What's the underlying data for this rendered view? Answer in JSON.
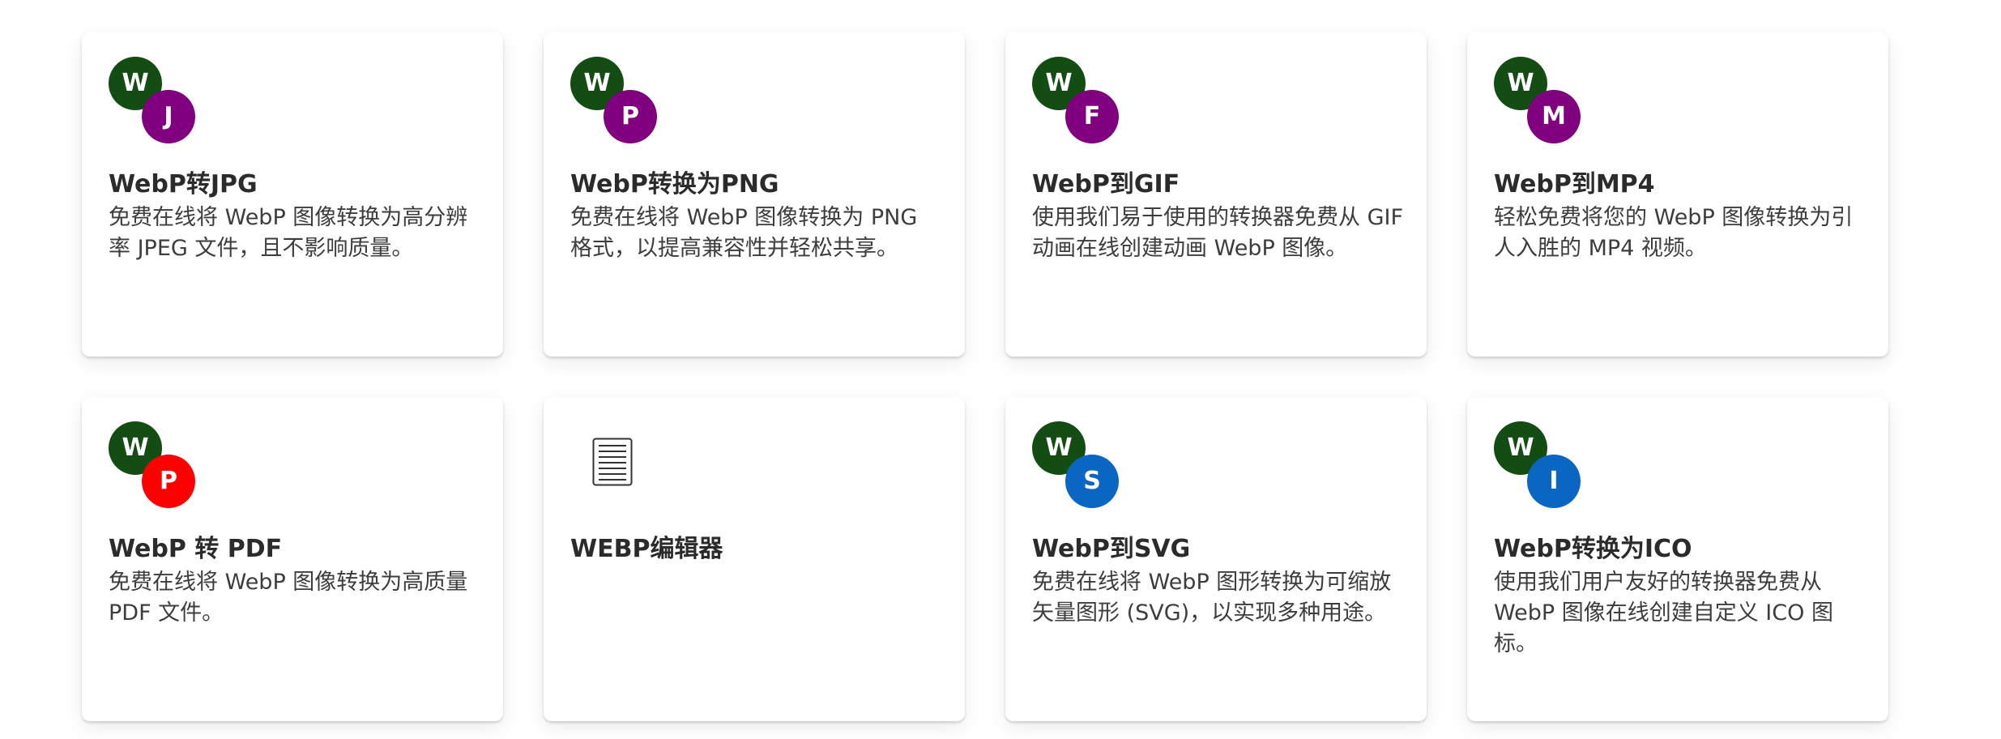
{
  "cards": [
    {
      "title": "WebP转JPG",
      "description": "免费在线将 WebP 图像转换为高分辨率 JPEG 文件，且不影响质量。",
      "icon_from": "W",
      "icon_to": "J",
      "from_color": "#144d14",
      "to_color": "#800080"
    },
    {
      "title": "WebP转换为PNG",
      "description": "免费在线将 WebP 图像转换为 PNG 格式，以提高兼容性并轻松共享。",
      "icon_from": "W",
      "icon_to": "P",
      "from_color": "#144d14",
      "to_color": "#800080"
    },
    {
      "title": "WebP到GIF",
      "description": "使用我们易于使用的转换器免费从 GIF 动画在线创建动画 WebP 图像。",
      "icon_from": "W",
      "icon_to": "F",
      "from_color": "#144d14",
      "to_color": "#800080"
    },
    {
      "title": "WebP到MP4",
      "description": "轻松免费将您的 WebP 图像转换为引人入胜的 MP4 视频。",
      "icon_from": "W",
      "icon_to": "M",
      "from_color": "#144d14",
      "to_color": "#800080"
    },
    {
      "title": "WebP 转 PDF",
      "description": "免费在线将 WebP 图像转换为高质量 PDF 文件。",
      "icon_from": "W",
      "icon_to": "P",
      "from_color": "#144d14",
      "to_color": "#ff0000"
    },
    {
      "title": "WEBP编辑器",
      "description": "",
      "icon": "document-icon"
    },
    {
      "title": "WebP到SVG",
      "description": "免费在线将 WebP 图形转换为可缩放矢量图形 (SVG)，以实现多种用途。",
      "icon_from": "W",
      "icon_to": "S",
      "from_color": "#144d14",
      "to_color": "#0a66c2"
    },
    {
      "title": "WebP转换为ICO",
      "description": "使用我们用户友好的转换器免费从 WebP 图像在线创建自定义 ICO 图标。",
      "icon_from": "W",
      "icon_to": "I",
      "from_color": "#144d14",
      "to_color": "#0a66c2"
    }
  ]
}
